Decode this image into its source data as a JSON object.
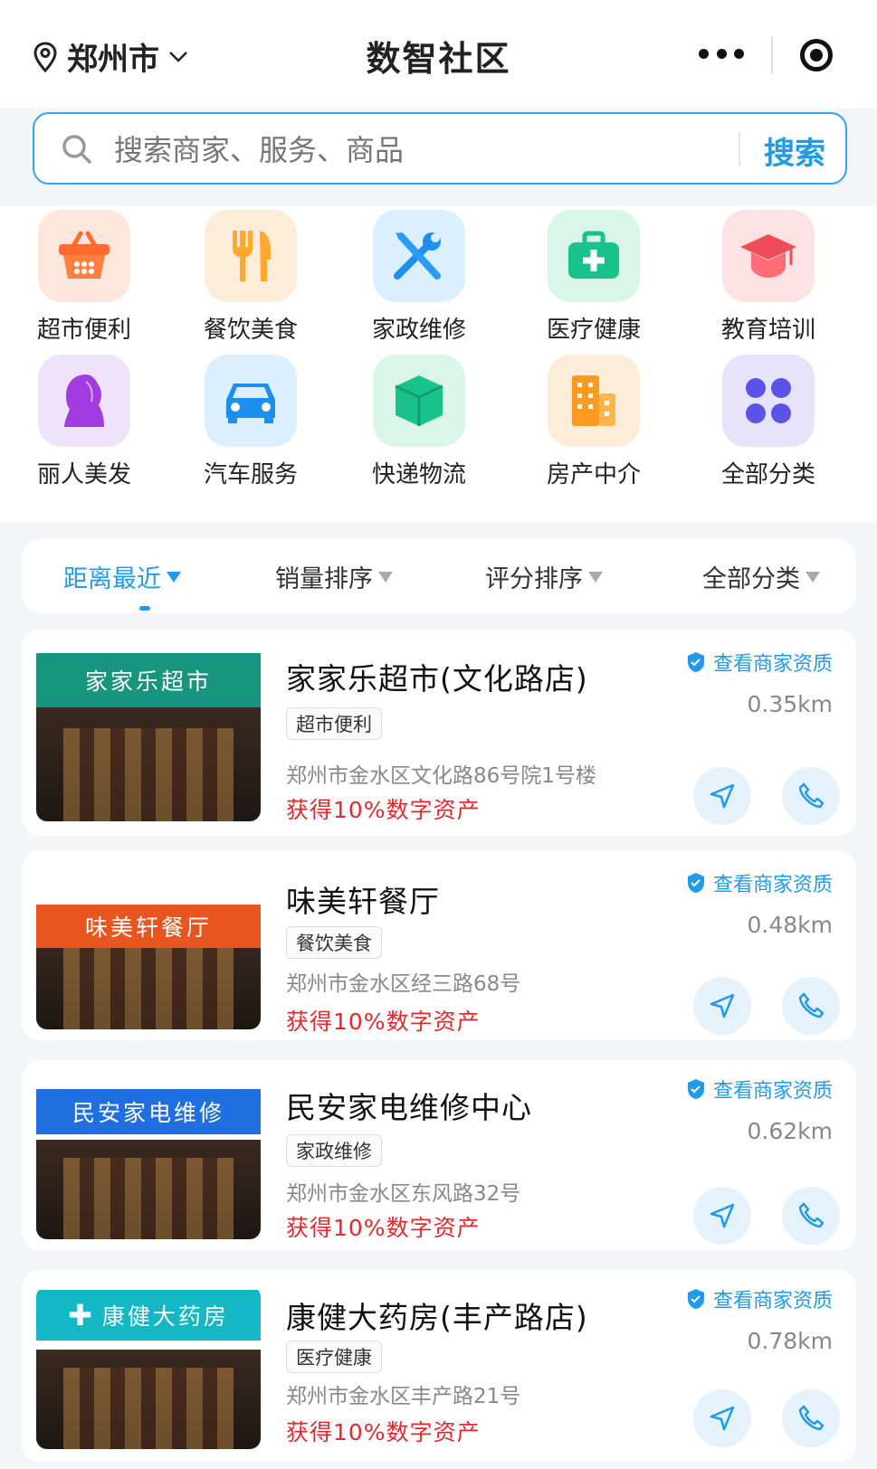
{
  "header": {
    "city": "郑州市",
    "title": "数智社区"
  },
  "search": {
    "placeholder": "搜索商家、服务、商品",
    "button": "搜索"
  },
  "categories": [
    {
      "label": "超市便利",
      "icon": "shopping-basket-icon"
    },
    {
      "label": "餐饮美食",
      "icon": "fork-knife-icon"
    },
    {
      "label": "家政维修",
      "icon": "wrench-screwdriver-icon"
    },
    {
      "label": "医疗健康",
      "icon": "medical-kit-icon"
    },
    {
      "label": "教育培训",
      "icon": "graduation-cap-icon"
    },
    {
      "label": "丽人美发",
      "icon": "woman-hair-icon"
    },
    {
      "label": "汽车服务",
      "icon": "car-icon"
    },
    {
      "label": "快递物流",
      "icon": "package-box-icon"
    },
    {
      "label": "房产中介",
      "icon": "building-icon"
    },
    {
      "label": "全部分类",
      "icon": "grid-dots-icon"
    }
  ],
  "sort": [
    {
      "label": "距离最近",
      "active": true
    },
    {
      "label": "销量排序",
      "active": false
    },
    {
      "label": "评分排序",
      "active": false
    },
    {
      "label": "全部分类",
      "active": false
    }
  ],
  "stores": [
    {
      "name": "家家乐超市(文化路店)",
      "tag": "超市便利",
      "address": "郑州市金水区文化路86号院1号楼",
      "reward": "获得10%数字资产",
      "qualification": "查看商家资质",
      "distance": "0.35km",
      "sign": "家家乐超市",
      "sign_color": "#17957e"
    },
    {
      "name": "味美轩餐厅",
      "tag": "餐饮美食",
      "address": "郑州市金水区经三路68号",
      "reward": "获得10%数字资产",
      "qualification": "查看商家资质",
      "distance": "0.48km",
      "sign": "味美轩餐厅",
      "sign_color": "#e8551f"
    },
    {
      "name": "民安家电维修中心",
      "tag": "家政维修",
      "address": "郑州市金水区东风路32号",
      "reward": "获得10%数字资产",
      "qualification": "查看商家资质",
      "distance": "0.62km",
      "sign": "民安家电维修",
      "sign_color": "#1f6fe0"
    },
    {
      "name": "康健大药房(丰产路店)",
      "tag": "医疗健康",
      "address": "郑州市金水区丰产路21号",
      "reward": "获得10%数字资产",
      "qualification": "查看商家资质",
      "distance": "0.78km",
      "sign": "康健大药房",
      "sign_color": "#13b7c5"
    }
  ],
  "colors": {
    "accent": "#1f9be8",
    "reward": "#e8262c"
  }
}
